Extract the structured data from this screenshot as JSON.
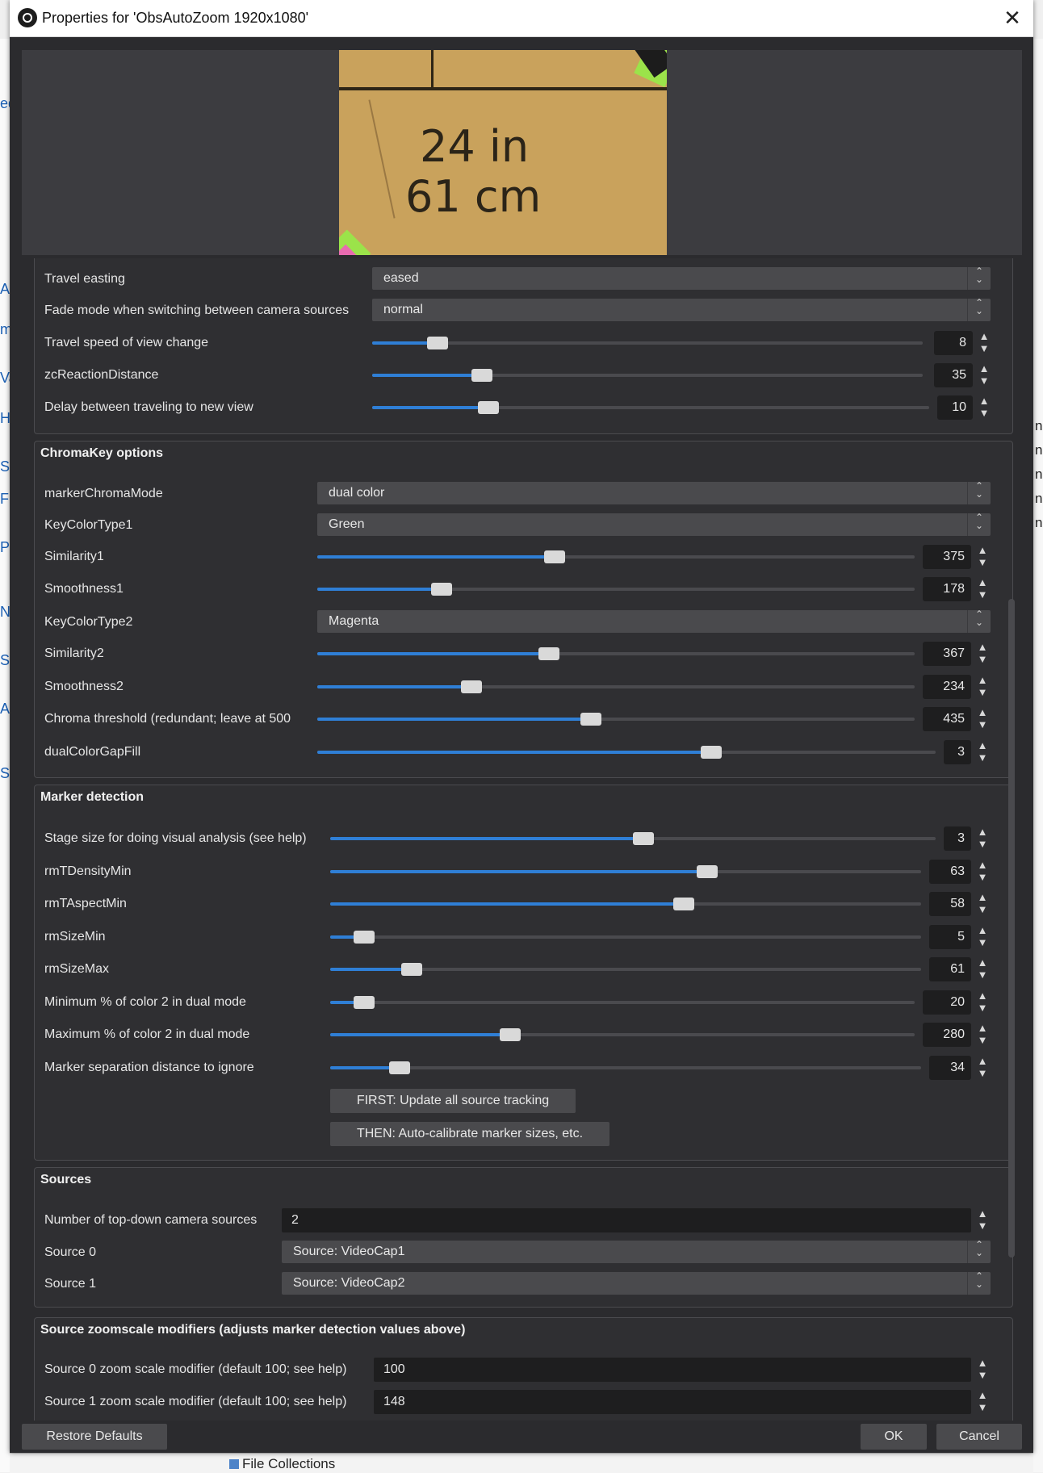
{
  "dialog": {
    "title": "Properties for 'ObsAutoZoom 1920x1080'",
    "close_glyph": "✕"
  },
  "preview": {
    "line1": "24 in",
    "line2": "61 cm"
  },
  "travel": {
    "easting_label": "Travel easting",
    "easting_value": "eased",
    "fade_label": "Fade mode when switching between camera sources",
    "fade_value": "normal",
    "speed_label": "Travel speed of view change",
    "speed_value": "8",
    "zc_label": "zcReactionDistance",
    "zc_value": "35",
    "delay_label": "Delay between traveling to new view",
    "delay_value": "10"
  },
  "chroma": {
    "title": "ChromaKey options",
    "mode_label": "markerChromaMode",
    "mode_value": "dual color",
    "key1_label": "KeyColorType1",
    "key1_value": "Green",
    "sim1_label": "Similarity1",
    "sim1_value": "375",
    "smooth1_label": "Smoothness1",
    "smooth1_value": "178",
    "key2_label": "KeyColorType2",
    "key2_value": "Magenta",
    "sim2_label": "Similarity2",
    "sim2_value": "367",
    "smooth2_label": "Smoothness2",
    "smooth2_value": "234",
    "threshold_label": "Chroma threshold (redundant; leave at 500",
    "threshold_value": "435",
    "gap_label": "dualColorGapFill",
    "gap_value": "3"
  },
  "marker": {
    "title": "Marker detection",
    "stage_label": "Stage size for doing visual analysis (see help)",
    "stage_value": "3",
    "density_label": "rmTDensityMin",
    "density_value": "63",
    "aspect_label": "rmTAspectMin",
    "aspect_value": "58",
    "sizemin_label": "rmSizeMin",
    "sizemin_value": "5",
    "sizemax_label": "rmSizeMax",
    "sizemax_value": "61",
    "minpct_label": "Minimum % of color 2 in dual mode",
    "minpct_value": "20",
    "maxpct_label": "Maximum % of color 2 in dual mode",
    "maxpct_value": "280",
    "sep_label": "Marker separation distance to ignore",
    "sep_value": "34",
    "update_btn": "FIRST: Update all source tracking",
    "calibrate_btn": "THEN: Auto-calibrate marker sizes, etc."
  },
  "sources": {
    "title": "Sources",
    "count_label": "Number of top-down camera sources",
    "count_value": "2",
    "src0_label": "Source 0",
    "src0_value": "Source: VideoCap1",
    "src1_label": "Source 1",
    "src1_value": "Source: VideoCap2"
  },
  "zoom": {
    "title": "Source zoomscale modifiers (adjusts marker detection values above)",
    "z0_label": "Source 0 zoom scale modifier (default 100; see help)",
    "z0_value": "100",
    "z1_label": "Source 1 zoom scale modifier (default 100; see help)",
    "z1_value": "148"
  },
  "footer": {
    "restore": "Restore Defaults",
    "ok": "OK",
    "cancel": "Cancel"
  },
  "background": {
    "file_collections": "File Collections"
  },
  "sliders": {
    "speed": 0.1,
    "zc": 0.18,
    "delay": 0.19,
    "sim1": 0.38,
    "smooth1": 0.19,
    "sim2": 0.37,
    "smooth2": 0.24,
    "threshold": 0.44,
    "gap": 0.62,
    "stage": 0.5,
    "density": 0.62,
    "aspect": 0.58,
    "sizemin": 0.04,
    "sizemax": 0.12,
    "minpct": 0.04,
    "maxpct": 0.29,
    "sep": 0.1
  },
  "colors": {
    "dialog_bg": "#2b2b2e",
    "accent": "#2f7fd6"
  }
}
